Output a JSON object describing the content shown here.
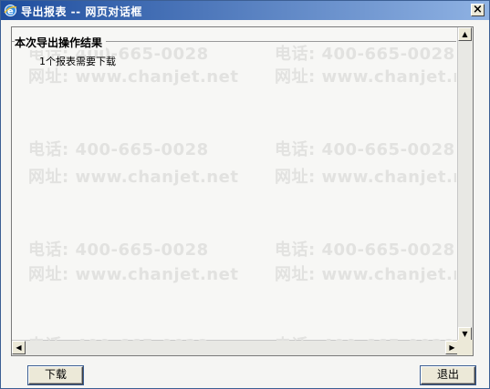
{
  "window": {
    "title": "导出报表 -- 网页对话框",
    "close_glyph": "×"
  },
  "group": {
    "title": "本次导出操作结果",
    "result_text": "1个报表需要下载"
  },
  "watermark": {
    "phone": "电话: 400-665-0028",
    "site": "网址: www.chanjet.net"
  },
  "buttons": {
    "download_label": "下载",
    "exit_label": "退出"
  },
  "colors": {
    "titlebar_start": "#1f4e9e",
    "titlebar_end": "#8fb2e3"
  }
}
